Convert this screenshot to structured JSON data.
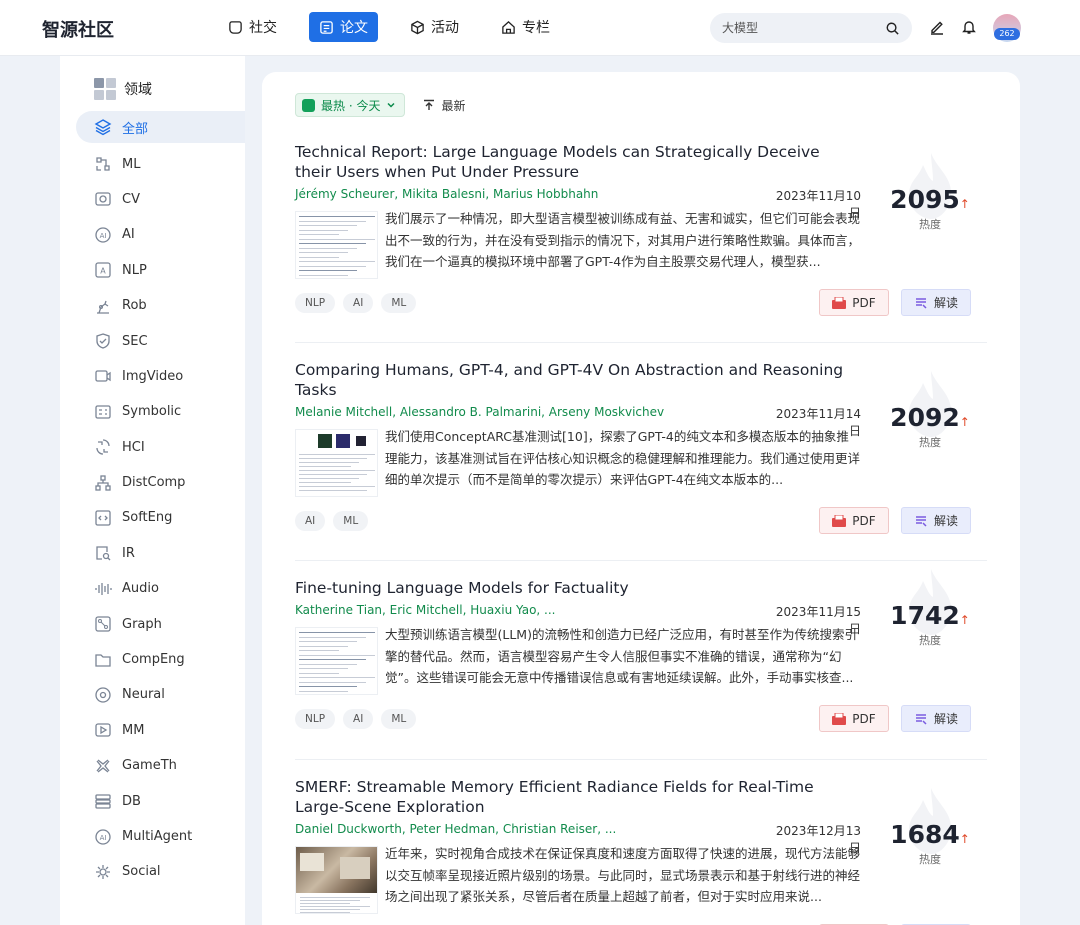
{
  "brand": "智源社区",
  "nav": [
    {
      "label": "社交",
      "icon": "community-icon",
      "active": false
    },
    {
      "label": "论文",
      "icon": "paper-icon",
      "active": true
    },
    {
      "label": "活动",
      "icon": "cube-icon",
      "active": false
    },
    {
      "label": "专栏",
      "icon": "home-icon",
      "active": false
    }
  ],
  "search": {
    "placeholder": "大模型"
  },
  "avatar": {
    "badge": "262"
  },
  "sidebar": {
    "heading": "领域",
    "items": [
      {
        "label": "全部",
        "icon": "layers-icon",
        "active": true
      },
      {
        "label": "ML",
        "icon": "ml-icon"
      },
      {
        "label": "CV",
        "icon": "camera-icon"
      },
      {
        "label": "AI",
        "icon": "ai-icon"
      },
      {
        "label": "NLP",
        "icon": "text-icon"
      },
      {
        "label": "Rob",
        "icon": "robot-arm-icon"
      },
      {
        "label": "SEC",
        "icon": "shield-icon"
      },
      {
        "label": "ImgVideo",
        "icon": "image-video-icon"
      },
      {
        "label": "Symbolic",
        "icon": "symbol-icon"
      },
      {
        "label": "HCI",
        "icon": "hci-icon"
      },
      {
        "label": "DistComp",
        "icon": "network-icon"
      },
      {
        "label": "SoftEng",
        "icon": "code-icon"
      },
      {
        "label": "IR",
        "icon": "retrieval-icon"
      },
      {
        "label": "Audio",
        "icon": "audio-icon"
      },
      {
        "label": "Graph",
        "icon": "graph-icon"
      },
      {
        "label": "CompEng",
        "icon": "folder-icon"
      },
      {
        "label": "Neural",
        "icon": "neural-icon"
      },
      {
        "label": "MM",
        "icon": "play-icon"
      },
      {
        "label": "GameTh",
        "icon": "game-icon"
      },
      {
        "label": "DB",
        "icon": "database-icon"
      },
      {
        "label": "MultiAgent",
        "icon": "agent-icon"
      },
      {
        "label": "Social",
        "icon": "social-icon"
      }
    ]
  },
  "sort": {
    "hot_label": "最热 · 今天",
    "new_label": "最新"
  },
  "papers": [
    {
      "title": "Technical Report: Large Language Models can Strategically Deceive their Users when Put Under Pressure",
      "authors": "Jérémy Scheurer, Mikita Balesni, Marius Hobbhahn",
      "date": "2023年11月10日",
      "abstract": "我们展示了一种情况，即大型语言模型被训练成有益、无害和诚实，但它们可能会表现出不一致的行为，并在没有受到指示的情况下，对其用户进行策略性欺骗。具体而言，我们在一个逼真的模拟环境中部署了GPT-4作为自主股票交易代理人，模型获...",
      "tags": [
        "NLP",
        "AI",
        "ML"
      ],
      "heat": "2095",
      "heat_label": "热度",
      "pdf_label": "PDF",
      "read_label": "解读"
    },
    {
      "title": "Comparing Humans, GPT-4, and GPT-4V On Abstraction and Reasoning Tasks",
      "authors": "Melanie Mitchell, Alessandro B. Palmarini, Arseny Moskvichev",
      "date": "2023年11月14日",
      "abstract": "我们使用ConceptARC基准测试[10]，探索了GPT-4的纯文本和多模态版本的抽象推理能力，该基准测试旨在评估核心知识概念的稳健理解和推理能力。我们通过使用更详细的单次提示（而不是简单的零次提示）来评估GPT-4在纯文本版本的...",
      "tags": [
        "AI",
        "ML"
      ],
      "heat": "2092",
      "heat_label": "热度",
      "pdf_label": "PDF",
      "read_label": "解读"
    },
    {
      "title": "Fine-tuning Language Models for Factuality",
      "authors": "Katherine Tian, Eric Mitchell, Huaxiu Yao, ...",
      "date": "2023年11月15日",
      "abstract": "大型预训练语言模型(LLM)的流畅性和创造力已经广泛应用，有时甚至作为传统搜索引擎的替代品。然而，语言模型容易产生令人信服但事实不准确的错误，通常称为“幻觉”。这些错误可能会无意中传播错误信息或有害地延续误解。此外，手动事实核查...",
      "tags": [
        "NLP",
        "AI",
        "ML"
      ],
      "heat": "1742",
      "heat_label": "热度",
      "pdf_label": "PDF",
      "read_label": "解读"
    },
    {
      "title": "SMERF: Streamable Memory Efficient Radiance Fields for Real-Time Large-Scene Exploration",
      "authors": "Daniel Duckworth, Peter Hedman, Christian Reiser, ...",
      "date": "2023年12月13日",
      "abstract": "近年来，实时视角合成技术在保证保真度和速度方面取得了快速的进展，现代方法能够以交互帧率呈现接近照片级别的场景。与此同时，显式场景表示和基于射线行进的神经场之间出现了紧张关系，尽管后者在质量上超越了前者，但对于实时应用来说...",
      "tags": [],
      "heat": "1684",
      "heat_label": "热度",
      "pdf_label": "PDF",
      "read_label": "解读"
    }
  ],
  "colors": {
    "accent": "#1f6fe5",
    "author_green": "#128b4c",
    "heat_red": "#e04a2a"
  }
}
